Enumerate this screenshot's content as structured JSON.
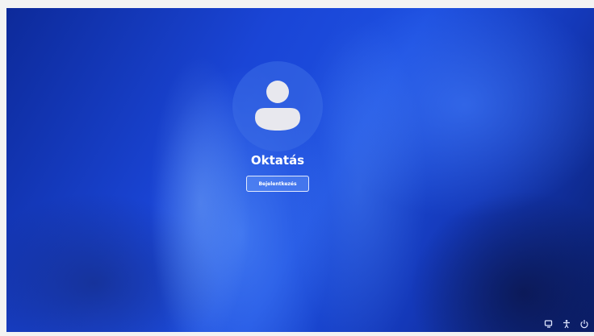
{
  "lock_screen": {
    "user_name": "Oktatás",
    "signin_label": "Bejelentkezés"
  },
  "tray": {
    "icons": [
      "network-icon",
      "accessibility-icon",
      "power-icon"
    ]
  },
  "colors": {
    "background_primary": "#1d4fe0",
    "background_dark": "#0a1f6e",
    "avatar_glyph": "#e8e8ee",
    "text": "#ffffff"
  }
}
